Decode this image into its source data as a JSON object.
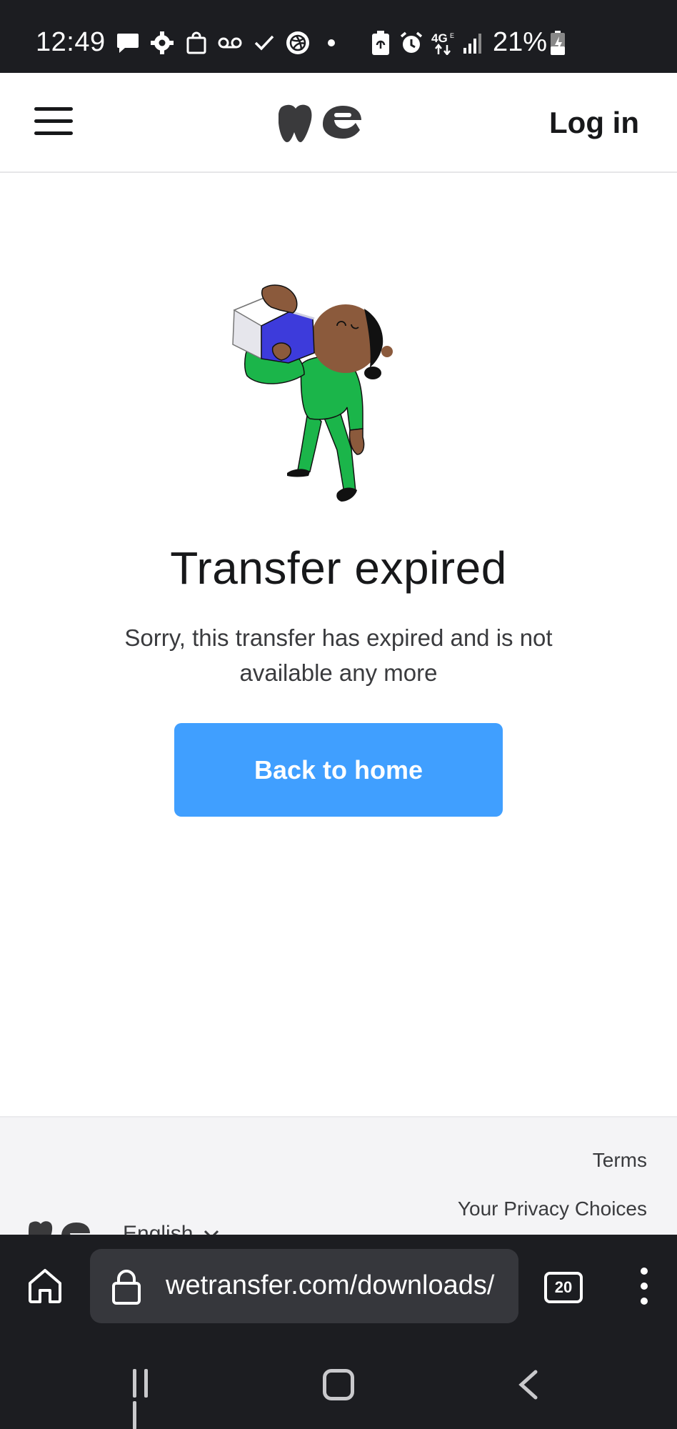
{
  "status_bar": {
    "time": "12:49",
    "battery": "21%",
    "icons": [
      "message-icon",
      "settings-icon",
      "shopping-bag-icon",
      "voicemail-icon",
      "check-icon",
      "dribbble-icon",
      "dot-icon",
      "battery-saver-icon",
      "alarm-icon",
      "4g-icon",
      "signal-icon",
      "battery-charging-icon"
    ]
  },
  "header": {
    "menu_icon": "hamburger-menu-icon",
    "logo_icon": "wetransfer-logo-icon",
    "login_label": "Log in"
  },
  "main": {
    "illustration": "person-drinking-illustration",
    "title": "Transfer expired",
    "message": "Sorry, this transfer has expired and is not available any more",
    "cta_label": "Back to home"
  },
  "footer": {
    "terms": "Terms",
    "privacy": "Your Privacy Choices",
    "language": "English",
    "language_icon": "chevron-down-icon"
  },
  "browser": {
    "home_icon": "home-icon",
    "lock_icon": "lock-icon",
    "url": "wetransfer.com/downloads/",
    "tab_count": "20",
    "more_icon": "more-vertical-icon"
  },
  "nav": {
    "recent_icon": "recent-apps-icon",
    "home_icon": "home-circle-icon",
    "back_icon": "back-icon"
  },
  "colors": {
    "accent": "#409fff",
    "system_bar": "#1c1d21",
    "footer_bg": "#f4f4f6",
    "illustration_green": "#1bb54a",
    "illustration_skin": "#8b5a3c",
    "illustration_blue": "#3d3bdb"
  }
}
